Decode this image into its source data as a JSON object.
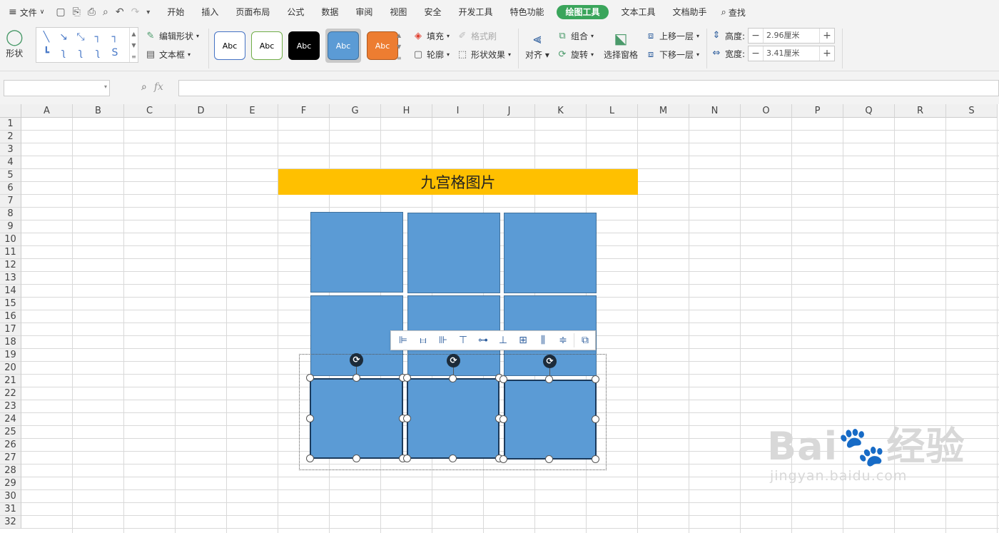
{
  "menubar": {
    "file_label": "文件",
    "tabs": [
      "开始",
      "插入",
      "页面布局",
      "公式",
      "数据",
      "审阅",
      "视图",
      "安全",
      "开发工具",
      "特色功能",
      "绘图工具",
      "文本工具",
      "文档助手"
    ],
    "active_tab": "绘图工具",
    "find_label": "查找"
  },
  "ribbon": {
    "shape_label": "形状",
    "edit_shape_label": "编辑形状",
    "textbox_label": "文本框",
    "styles": [
      {
        "text": "Abc",
        "bg": "#ffffff",
        "border": "#4472c4",
        "color": "#000000"
      },
      {
        "text": "Abc",
        "bg": "#ffffff",
        "border": "#70ad47",
        "color": "#000000"
      },
      {
        "text": "Abc",
        "bg": "#000000",
        "border": "#000000",
        "color": "#ffffff"
      },
      {
        "text": "Abc",
        "bg": "#5b9bd5",
        "border": "#41719c",
        "color": "#ffffff"
      },
      {
        "text": "Abc",
        "bg": "#ed7d31",
        "border": "#ae5a21",
        "color": "#ffffff"
      }
    ],
    "fill_label": "填充",
    "format_painter_label": "格式刷",
    "outline_label": "轮廓",
    "shape_effect_label": "形状效果",
    "align_label": "对齐",
    "group_label": "组合",
    "rotate_label": "旋转",
    "select_pane_label": "选择窗格",
    "bring_forward_label": "上移一层",
    "send_backward_label": "下移一层",
    "height_label": "高度:",
    "height_value": "2.96厘米",
    "width_label": "宽度:",
    "width_value": "3.41厘米"
  },
  "formula_bar": {
    "fx_label": "fx",
    "name_box_value": "",
    "formula_value": ""
  },
  "sheet": {
    "columns": [
      "A",
      "B",
      "C",
      "D",
      "E",
      "F",
      "G",
      "H",
      "I",
      "J",
      "K",
      "L",
      "M",
      "N",
      "O",
      "P",
      "Q",
      "R",
      "S"
    ],
    "rows": [
      "1",
      "2",
      "3",
      "4",
      "5",
      "6",
      "7",
      "8",
      "9",
      "10",
      "11",
      "12",
      "13",
      "14",
      "15",
      "16",
      "17",
      "18",
      "19",
      "20",
      "21",
      "22",
      "23",
      "24",
      "25",
      "26",
      "27",
      "28",
      "29",
      "30",
      "31",
      "32"
    ],
    "banner_text": "九宫格图片",
    "banner_color": "#ffc000",
    "tile_color": "#5b9bd5"
  },
  "float_toolbar": {
    "icons": [
      "align-left-icon",
      "align-center-icon",
      "align-right-icon",
      "align-top-icon",
      "align-middle-icon",
      "align-bottom-icon",
      "distribute-icon",
      "distribute-horizontal-icon",
      "distribute-vertical-icon",
      "group-icon"
    ]
  },
  "watermark": {
    "brand": "Bai",
    "brand_cn": "经验",
    "url": "jingyan.baidu.com"
  }
}
